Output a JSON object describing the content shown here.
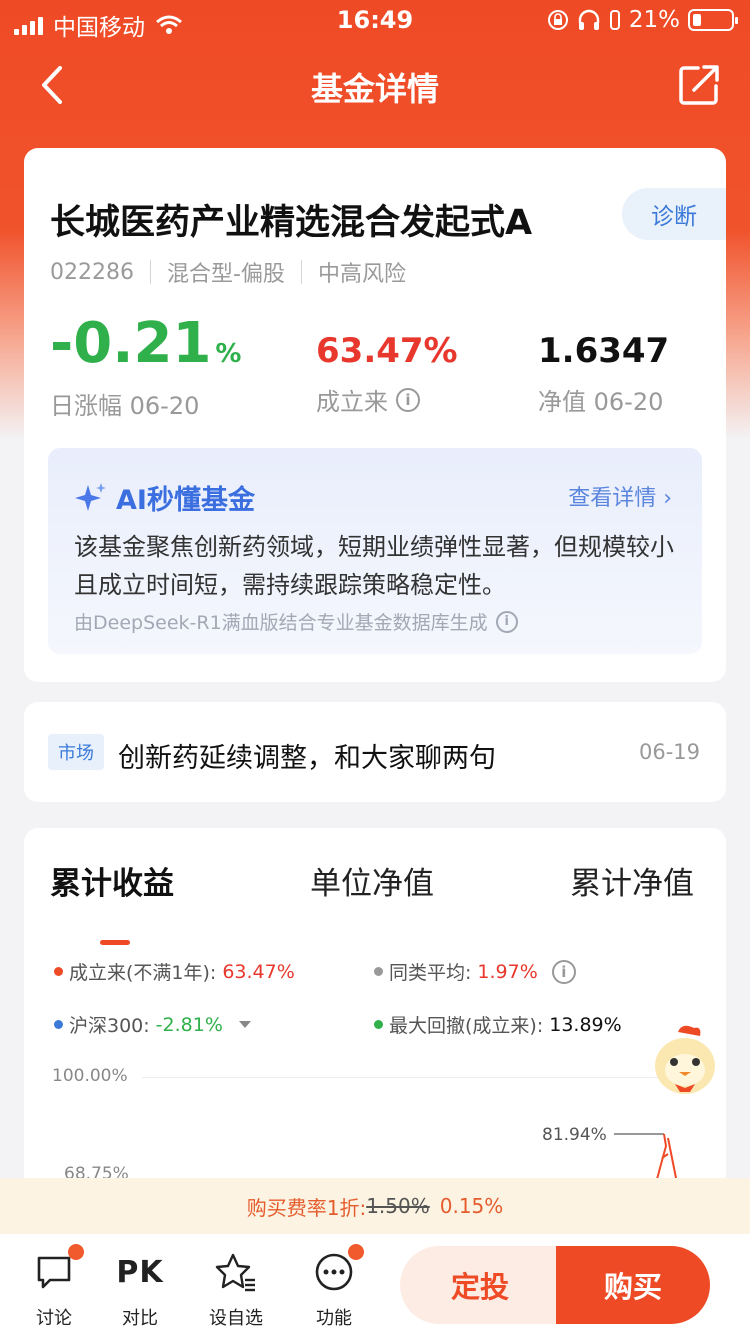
{
  "status_bar": {
    "carrier": "中国移动",
    "time": "16:49",
    "battery": "21%"
  },
  "nav": {
    "title": "基金详情"
  },
  "fund": {
    "name": "长城医药产业精选混合发起式A",
    "diagnose_label": "诊断",
    "code": "022286",
    "type": "混合型-偏股",
    "risk": "中高风险",
    "daily_change": "-0.21",
    "daily_change_unit": "%",
    "daily_change_label": "日涨幅 06-20",
    "since_inception": "63.47%",
    "since_inception_label": "成立来",
    "nav_value": "1.6347",
    "nav_label": "净值 06-20"
  },
  "ai": {
    "title": "AI秒懂基金",
    "more_label": "查看详情 ›",
    "body": "该基金聚焦创新药领域，短期业绩弹性显著，但规模较小且成立时间短，需持续跟踪策略稳定性。",
    "source": "由DeepSeek-R1满血版结合专业基金数据库生成"
  },
  "news": {
    "tag": "市场",
    "title": "创新药延续调整，和大家聊两句",
    "date": "06-19"
  },
  "chart": {
    "tabs": [
      "累计收益",
      "单位净值",
      "累计净值"
    ],
    "legend": [
      {
        "label": "成立来(不满1年):",
        "value": "63.47%",
        "color": "#ef4a26"
      },
      {
        "label": "同类平均:",
        "value": "1.97%",
        "color": "#999999"
      },
      {
        "label": "沪深300:",
        "value": "-2.81%",
        "color": "#3b7ad9"
      },
      {
        "label": "最大回撤(成立来):",
        "value": "13.89%",
        "color": "#2fb04a"
      }
    ],
    "axis": [
      "100.00%",
      "68.75%"
    ],
    "peak": "81.94%"
  },
  "fee": {
    "label": "购买费率1折:",
    "old": "1.50%",
    "new": "0.15%"
  },
  "bottom": {
    "discuss": "讨论",
    "pk_icon": "PK",
    "compare": "对比",
    "watchlist": "设自选",
    "functions": "功能",
    "invest": "定投",
    "buy": "购买"
  },
  "colors": {
    "brand": "#ef4a26",
    "up": "#e8372c",
    "down": "#2fb04a",
    "ai": "#3b6fe0"
  }
}
